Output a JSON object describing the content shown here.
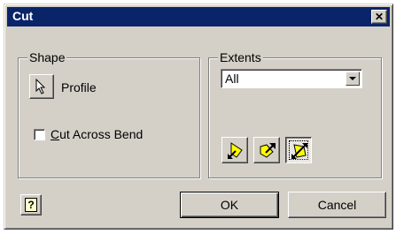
{
  "window": {
    "title": "Cut",
    "close_label": "✕"
  },
  "shape": {
    "legend": "Shape",
    "profile_label": "Profile",
    "cut_across_bend": {
      "label_first": "C",
      "label_rest": "ut Across Bend",
      "checked": false
    }
  },
  "extents": {
    "legend": "Extents",
    "selected": "All",
    "buttons": [
      "direction-1-icon",
      "direction-2-icon",
      "symmetric-icon"
    ],
    "active_index": 2
  },
  "footer": {
    "help_label": "?",
    "ok_label": "OK",
    "cancel_label": "Cancel"
  },
  "colors": {
    "title_bg": "#0a246a",
    "face": "#d4d0c8",
    "icon_yellow": "#ffff00"
  }
}
